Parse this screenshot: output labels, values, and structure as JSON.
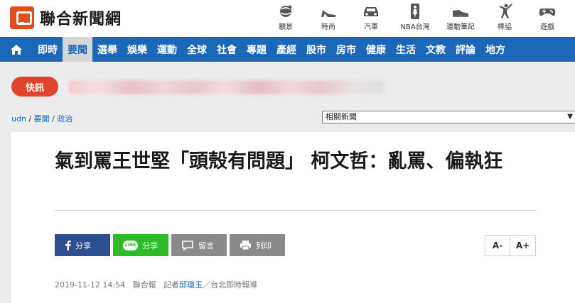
{
  "brand": {
    "name": "聯合新聞網"
  },
  "header_categories": [
    {
      "label": "願景",
      "icon": "globe-icon"
    },
    {
      "label": "時尚",
      "icon": "high-heel-icon"
    },
    {
      "label": "汽車",
      "icon": "car-icon"
    },
    {
      "label": "NBA台灣",
      "icon": "nba-icon"
    },
    {
      "label": "運動筆記",
      "icon": "sneaker-icon"
    },
    {
      "label": "棒協",
      "icon": "baseball-player-icon"
    },
    {
      "label": "遊戲",
      "icon": "gamepad-icon"
    }
  ],
  "nav": {
    "items": [
      "即時",
      "要聞",
      "選舉",
      "娛樂",
      "運動",
      "全球",
      "社會",
      "專題",
      "產經",
      "股市",
      "房市",
      "健康",
      "生活",
      "文教",
      "評論",
      "地方"
    ],
    "active": "要聞"
  },
  "breaking": {
    "label": "快訊"
  },
  "breadcrumb": {
    "home": "udn",
    "sep": " / ",
    "section": "要聞",
    "sub": "政治"
  },
  "related": {
    "label": "相關新聞"
  },
  "article": {
    "title": "氣到罵王世堅「頭殼有問題」 柯文哲：亂罵、偏執狂",
    "date": "2019-11-12 14:54",
    "source": "聯合報",
    "reporter_prefix": "記者",
    "reporter": "邱瓊玉",
    "location": "／台北即時報導"
  },
  "share": {
    "facebook": "分享",
    "line": "分享",
    "line_badge": "LINE",
    "comment": "留言",
    "print": "列印"
  },
  "font_controls": {
    "decrease": "A-",
    "increase": "A+"
  },
  "colors": {
    "nav": "#1b67b8",
    "breaking": "#e0452b",
    "logo": "#e04e1f",
    "facebook": "#2e4f8f",
    "line": "#2dbc27"
  }
}
